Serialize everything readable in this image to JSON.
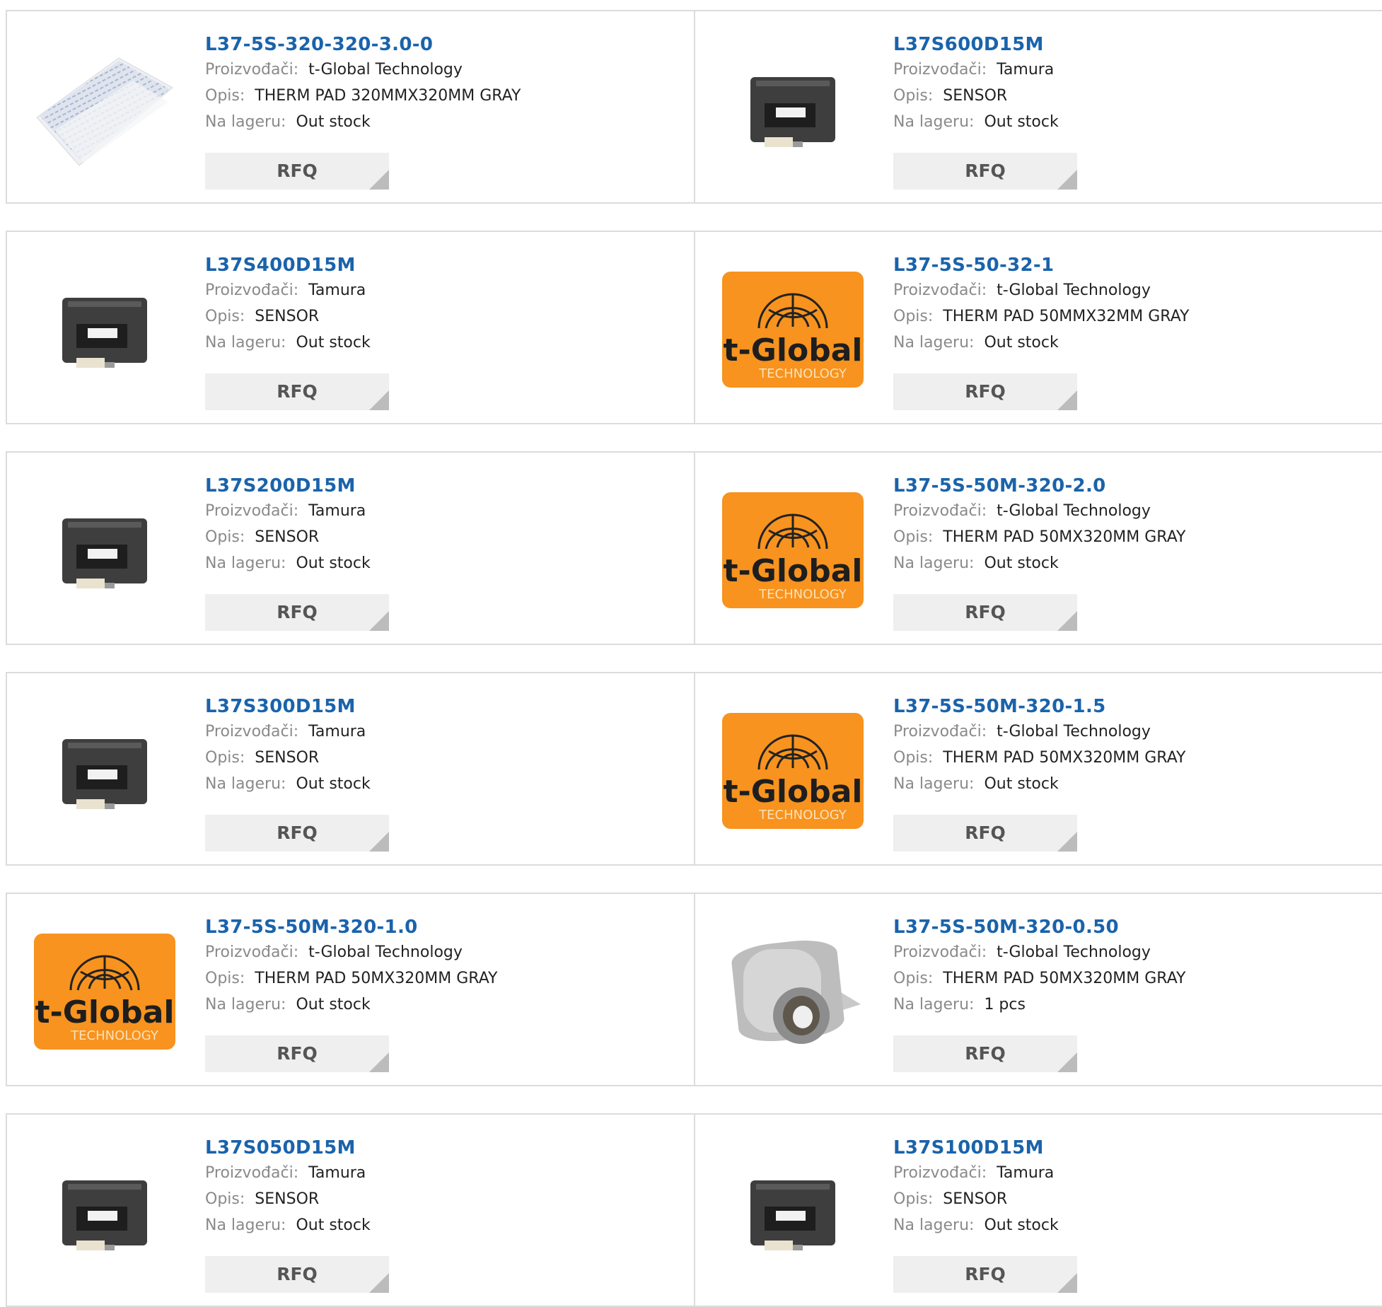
{
  "labels": {
    "manufacturer": "Proizvođači:",
    "description": "Opis:",
    "stock": "Na lageru:",
    "rfq": "RFQ"
  },
  "colors": {
    "link": "#1a63ab",
    "logo_orange": "#f7931e",
    "button_bg": "#efefef"
  },
  "products": [
    {
      "part": "L37-5S-320-320-3.0-0",
      "manufacturer": "t-Global Technology",
      "description": "THERM PAD 320MMX320MM GRAY",
      "stock": "Out stock",
      "image": "sheet-pad"
    },
    {
      "part": "L37S600D15M",
      "manufacturer": "Tamura",
      "description": "SENSOR",
      "stock": "Out stock",
      "image": "sensor"
    },
    {
      "part": "L37S400D15M",
      "manufacturer": "Tamura",
      "description": "SENSOR",
      "stock": "Out stock",
      "image": "sensor"
    },
    {
      "part": "L37-5S-50-32-1",
      "manufacturer": "t-Global Technology",
      "description": "THERM PAD 50MMX32MM GRAY",
      "stock": "Out stock",
      "image": "tglobal-logo"
    },
    {
      "part": "L37S200D15M",
      "manufacturer": "Tamura",
      "description": "SENSOR",
      "stock": "Out stock",
      "image": "sensor"
    },
    {
      "part": "L37-5S-50M-320-2.0",
      "manufacturer": "t-Global Technology",
      "description": "THERM PAD 50MX320MM GRAY",
      "stock": "Out stock",
      "image": "tglobal-logo"
    },
    {
      "part": "L37S300D15M",
      "manufacturer": "Tamura",
      "description": "SENSOR",
      "stock": "Out stock",
      "image": "sensor"
    },
    {
      "part": "L37-5S-50M-320-1.5",
      "manufacturer": "t-Global Technology",
      "description": "THERM PAD 50MX320MM GRAY",
      "stock": "Out stock",
      "image": "tglobal-logo"
    },
    {
      "part": "L37-5S-50M-320-1.0",
      "manufacturer": "t-Global Technology",
      "description": "THERM PAD 50MX320MM GRAY",
      "stock": "Out stock",
      "image": "tglobal-logo"
    },
    {
      "part": "L37-5S-50M-320-0.50",
      "manufacturer": "t-Global Technology",
      "description": "THERM PAD 50MX320MM GRAY",
      "stock": "1 pcs",
      "image": "film-roll"
    },
    {
      "part": "L37S050D15M",
      "manufacturer": "Tamura",
      "description": "SENSOR",
      "stock": "Out stock",
      "image": "sensor"
    },
    {
      "part": "L37S100D15M",
      "manufacturer": "Tamura",
      "description": "SENSOR",
      "stock": "Out stock",
      "image": "sensor"
    }
  ]
}
